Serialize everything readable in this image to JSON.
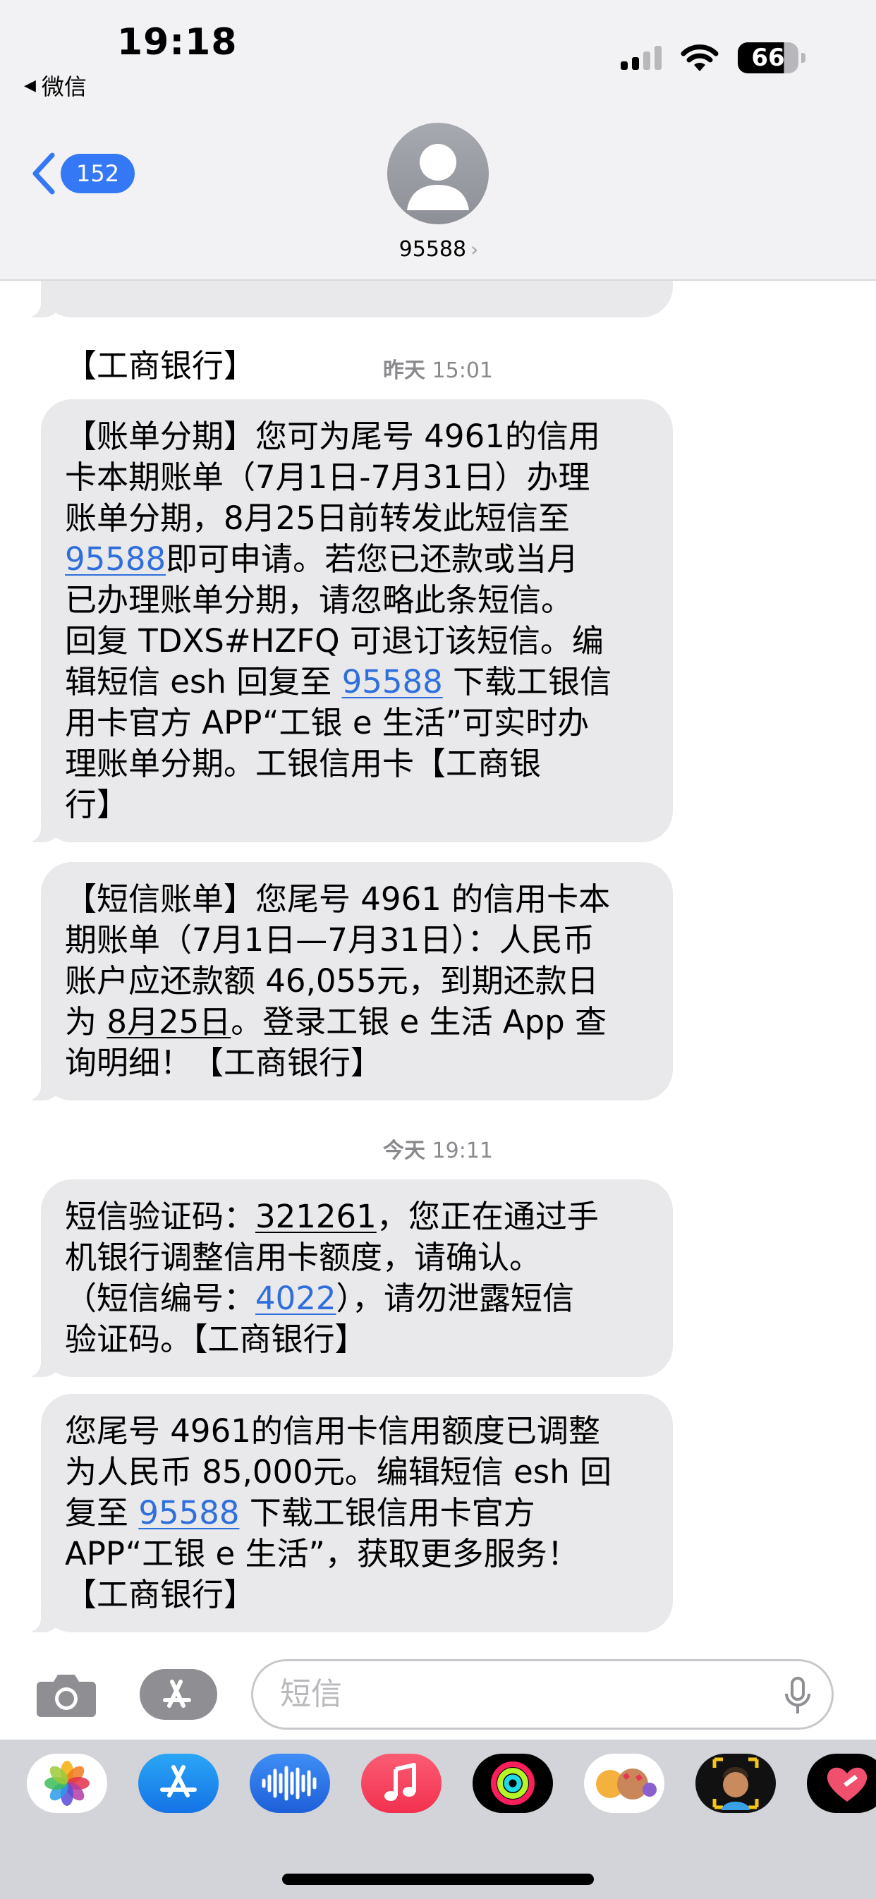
{
  "status_bar": {
    "time": "19:18",
    "back_app": "微信",
    "battery": "66"
  },
  "nav": {
    "unread_count": "152",
    "contact_name": "95588",
    "chevron": "›"
  },
  "messages": [
    {
      "partial": "【工商银行】"
    },
    {
      "timestamp_day": "昨天",
      "timestamp_time": "15:01",
      "lines": [
        [
          {
            "t": "【账单分期】您可为尾号 4961的信用"
          }
        ],
        [
          {
            "t": "卡本期账单（7月1日-7月31日）办理"
          }
        ],
        [
          {
            "t": "账单分期，8月25日前转发此短信至"
          }
        ],
        [
          {
            "t": "95588",
            "s": "link"
          },
          {
            "t": "即可申请。若您已还款或当月"
          }
        ],
        [
          {
            "t": "已办理账单分期，请忽略此条短信。"
          }
        ],
        [
          {
            "t": "回复 TDXS#HZFQ 可退订该短信。编"
          }
        ],
        [
          {
            "t": "辑短信 esh 回复至 "
          },
          {
            "t": "95588",
            "s": "link"
          },
          {
            "t": " 下载工银信"
          }
        ],
        [
          {
            "t": "用卡官方 APP“工银 e 生活”可实时办"
          }
        ],
        [
          {
            "t": "理账单分期。工银信用卡【工商银"
          }
        ],
        [
          {
            "t": "行】"
          }
        ]
      ]
    },
    {
      "lines": [
        [
          {
            "t": "【短信账单】您尾号 4961 的信用卡本"
          }
        ],
        [
          {
            "t": "期账单（7月1日—7月31日）：人民币"
          }
        ],
        [
          {
            "t": "账户应还款额 46,055元，到期还款日"
          }
        ],
        [
          {
            "t": "为 "
          },
          {
            "t": "8月25日",
            "s": "ul"
          },
          {
            "t": "。登录工银 e 生活 App 查"
          }
        ],
        [
          {
            "t": "询明细！【工商银行】"
          }
        ]
      ]
    },
    {
      "timestamp_day": "今天",
      "timestamp_time": "19:11",
      "lines": [
        [
          {
            "t": "短信验证码："
          },
          {
            "t": "321261",
            "s": "ul"
          },
          {
            "t": "，您正在通过手"
          }
        ],
        [
          {
            "t": "机银行调整信用卡额度，请确认。"
          }
        ],
        [
          {
            "t": "（短信编号："
          },
          {
            "t": "4022",
            "s": "link"
          },
          {
            "t": "），请勿泄露短信"
          }
        ],
        [
          {
            "t": "验证码。【工商银行】"
          }
        ]
      ]
    },
    {
      "lines": [
        [
          {
            "t": "您尾号 4961的信用卡信用额度已调整"
          }
        ],
        [
          {
            "t": "为人民币 85,000元。编辑短信 esh 回"
          }
        ],
        [
          {
            "t": "复至 "
          },
          {
            "t": "95588",
            "s": "link"
          },
          {
            "t": " 下载工银信用卡官方"
          }
        ],
        [
          {
            "t": "APP“工银 e 生活”，获取更多服务！"
          }
        ],
        [
          {
            "t": "【工商银行】"
          }
        ]
      ]
    }
  ],
  "composer": {
    "placeholder": "短信"
  },
  "drawer_apps": [
    "photos-icon",
    "app-store-icon",
    "audio-message-icon",
    "music-icon",
    "fitness-icon",
    "memoji-stickers-icon",
    "memoji-icon",
    "digital-touch-icon"
  ],
  "colors": {
    "link": "#2f6fdc",
    "badge": "#3478f6",
    "bubble": "#e9e9eb",
    "header": "#f2f2f4"
  }
}
